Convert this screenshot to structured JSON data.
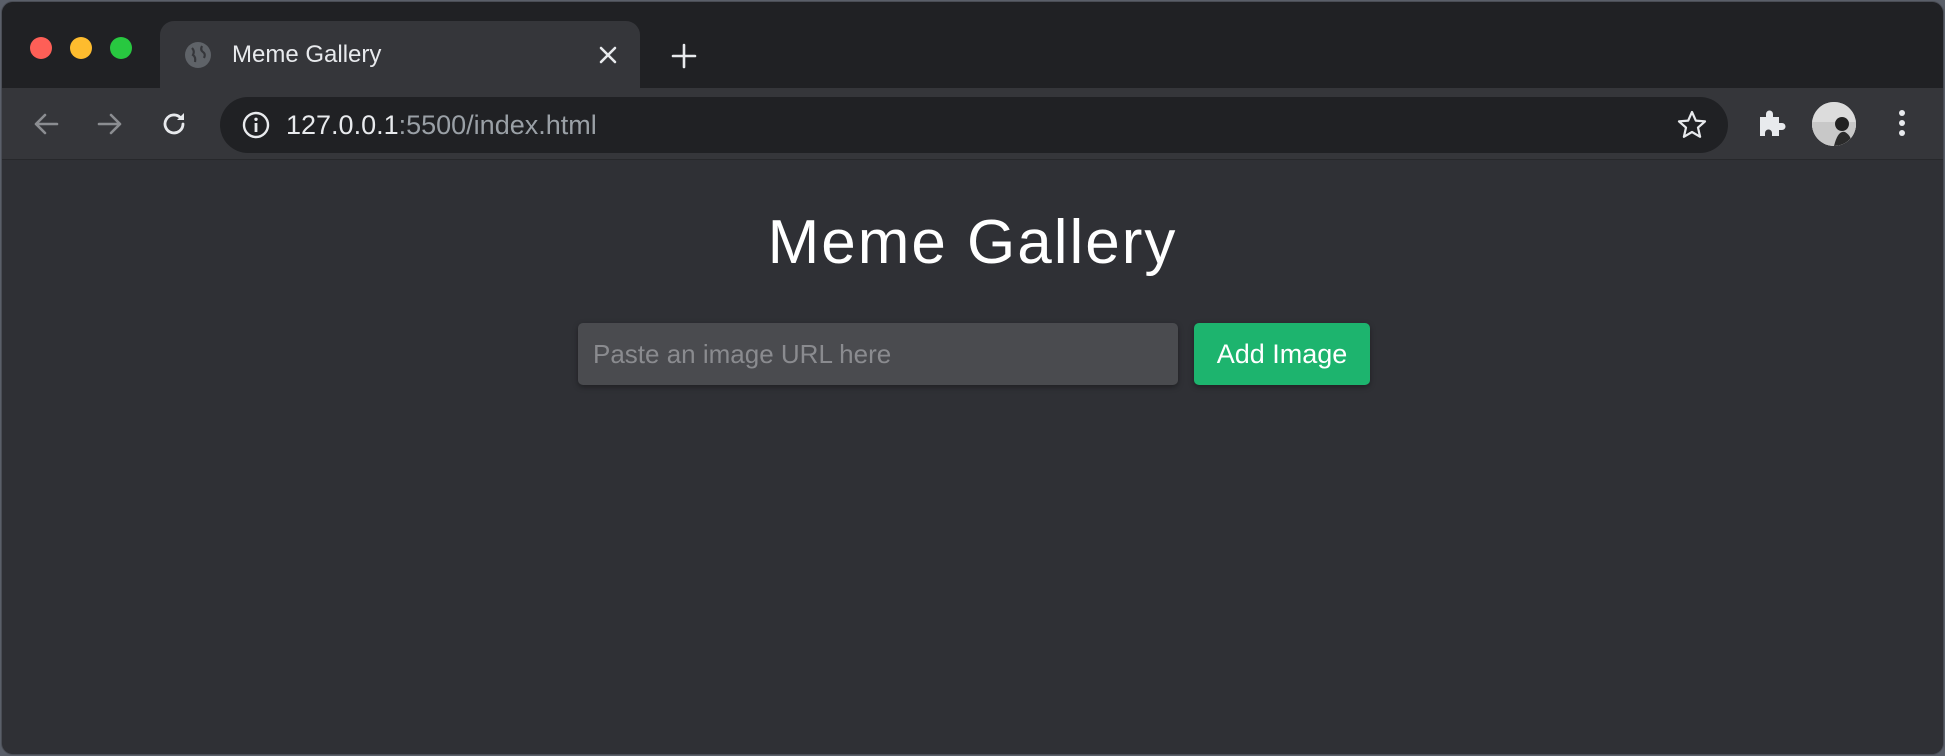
{
  "browser": {
    "tab": {
      "title": "Meme Gallery",
      "icon": "globe-icon"
    },
    "address_bar": {
      "host": "127.0.0.1",
      "rest": ":5500/index.html"
    },
    "icons": [
      "back-arrow-icon",
      "forward-arrow-icon",
      "reload-icon",
      "info-icon",
      "star-icon",
      "puzzle-extensions-icon",
      "avatar",
      "kebab-menu-icon",
      "close-icon",
      "plus-icon"
    ]
  },
  "page": {
    "title": "Meme Gallery",
    "input_placeholder": "Paste an image URL here",
    "button_label": "Add Image"
  },
  "colors": {
    "background": "#2f3035",
    "input_bg": "#4a4b4f",
    "button_accent": "#1db46e",
    "title_text": "#ffffff"
  }
}
